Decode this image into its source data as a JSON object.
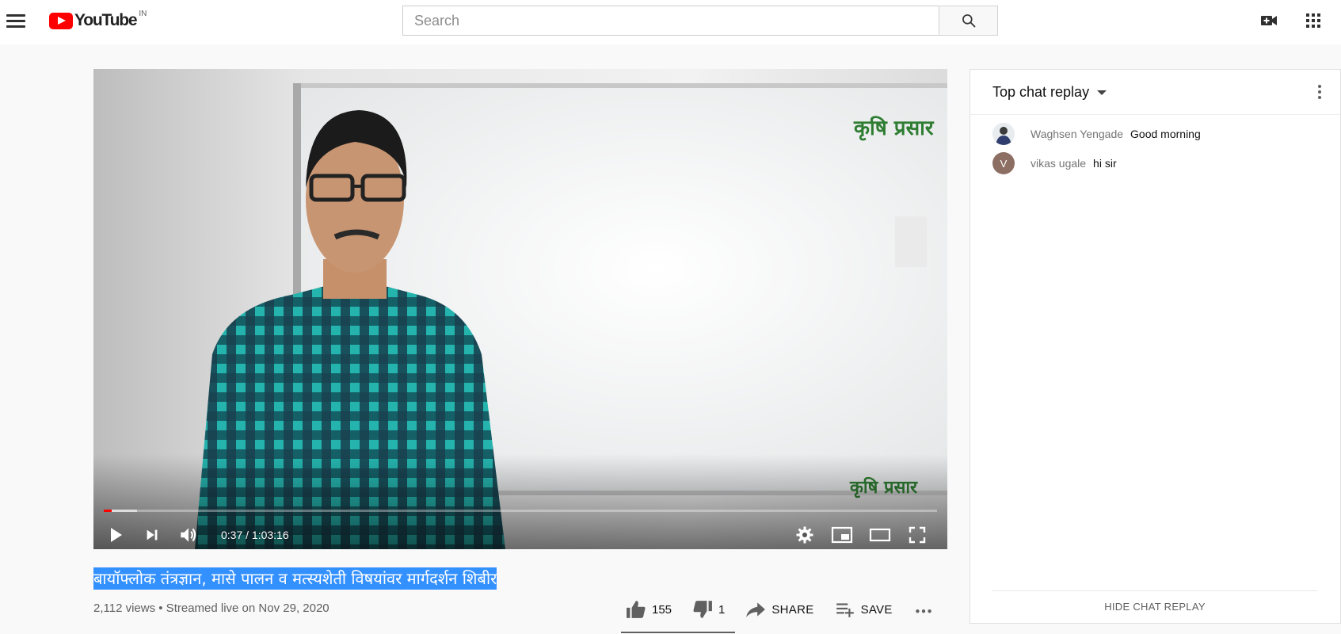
{
  "header": {
    "logo_text": "YouTube",
    "country_code": "IN",
    "search_placeholder": "Search"
  },
  "player": {
    "current_time": "0:37",
    "duration": "1:03:16",
    "progress_fraction": 0.0098,
    "buffered_fraction": 0.04,
    "watermark_text": "कृषि प्रसार"
  },
  "video": {
    "title": "बायॉफ्लोक तंत्रज्ञान, मासे पालन व मत्स्यशेती विषयांवर मार्गदर्शन शिबीर",
    "meta": "2,112 views • Streamed live on Nov 29, 2020",
    "likes": "155",
    "dislikes": "1",
    "share_label": "SHARE",
    "save_label": "SAVE"
  },
  "chat": {
    "title": "Top chat replay",
    "messages": [
      {
        "author": "Waghsen Yengade",
        "text": "Good morning",
        "avatar_letter": ""
      },
      {
        "author": "vikas ugale",
        "text": "hi sir",
        "avatar_letter": "V"
      }
    ],
    "hide_label": "HIDE CHAT REPLAY"
  },
  "colors": {
    "brand_red": "#ff0000",
    "selection_blue": "#3390ff",
    "avatar_brown": "#8d6e63"
  }
}
